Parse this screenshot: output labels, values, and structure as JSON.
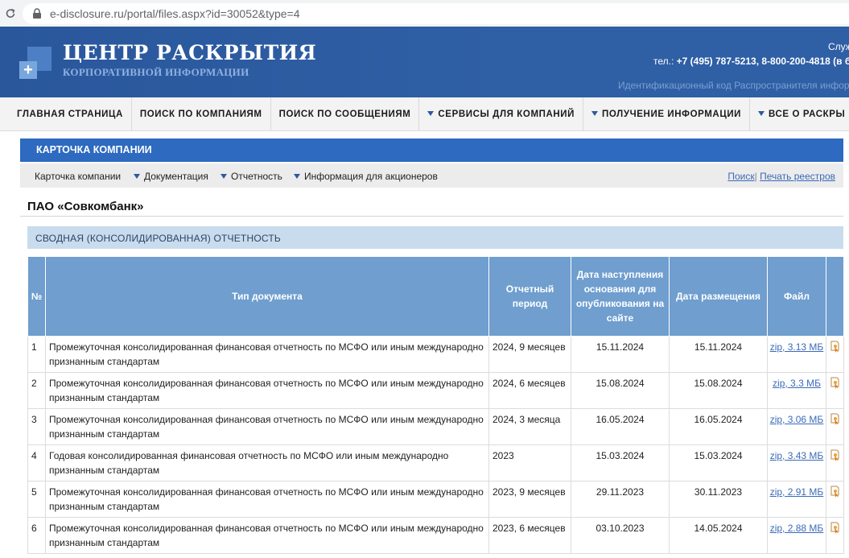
{
  "browser": {
    "url": "e-disclosure.ru/portal/files.aspx?id=30052&type=4"
  },
  "header": {
    "title": "ЦЕНТР РАСКРЫТИЯ",
    "subtitle": "КОРПОРАТИВНОЙ ИНФОРМАЦИИ",
    "service_label": "Служ",
    "phone_label": "тел.: ",
    "phone_values": "+7 (495) 787-5213, 8-800-200-4818 (в б",
    "distributor_id": "Идентификационный код Распространителя инфор"
  },
  "main_nav": [
    {
      "label": "ГЛАВНАЯ СТРАНИЦА",
      "dropdown": false
    },
    {
      "label": "ПОИСК ПО КОМПАНИЯМ",
      "dropdown": false
    },
    {
      "label": "ПОИСК ПО СООБЩЕНИЯМ",
      "dropdown": false
    },
    {
      "label": "СЕРВИСЫ ДЛЯ КОМПАНИЙ",
      "dropdown": true
    },
    {
      "label": "ПОЛУЧЕНИЕ ИНФОРМАЦИИ",
      "dropdown": true
    },
    {
      "label": "ВСЕ О РАСКРЫ",
      "dropdown": true
    }
  ],
  "card": {
    "title": "КАРТОЧКА КОМПАНИИ",
    "subnav": [
      {
        "label": "Карточка компании",
        "dropdown": false
      },
      {
        "label": "Документация",
        "dropdown": true
      },
      {
        "label": "Отчетность",
        "dropdown": true
      },
      {
        "label": "Информация для акционеров",
        "dropdown": true
      }
    ],
    "search_link": "Поиск",
    "separator": "|",
    "print_link": "Печать реестров"
  },
  "company_name": "ПАО «Совкомбанк»",
  "section_title": "СВОДНАЯ (КОНСОЛИДИРОВАННАЯ) ОТЧЕТНОСТЬ",
  "table": {
    "headers": {
      "num": "№",
      "type": "Тип документа",
      "period": "Отчетный период",
      "basis_date": "Дата наступления основания для опубликования на сайте",
      "placed_date": "Дата размещения",
      "file": "Файл"
    },
    "rows": [
      {
        "num": "1",
        "type": "Промежуточная консолидированная финансовая отчетность по МСФО или иным международно признанным стандартам",
        "period": "2024, 9 месяцев",
        "basis_date": "15.11.2024",
        "placed_date": "15.11.2024",
        "file": "zip, 3.13 МБ"
      },
      {
        "num": "2",
        "type": "Промежуточная консолидированная финансовая отчетность по МСФО или иным международно признанным стандартам",
        "period": "2024, 6 месяцев",
        "basis_date": "15.08.2024",
        "placed_date": "15.08.2024",
        "file": "zip, 3.3 МБ"
      },
      {
        "num": "3",
        "type": "Промежуточная консолидированная финансовая отчетность по МСФО или иным международно признанным стандартам",
        "period": "2024, 3 месяца",
        "basis_date": "16.05.2024",
        "placed_date": "16.05.2024",
        "file": "zip, 3.06 МБ"
      },
      {
        "num": "4",
        "type": "Годовая консолидированная финансовая отчетность по МСФО или иным международно признанным стандартам",
        "period": "2023",
        "basis_date": "15.03.2024",
        "placed_date": "15.03.2024",
        "file": "zip, 3.43 МБ"
      },
      {
        "num": "5",
        "type": "Промежуточная консолидированная финансовая отчетность по МСФО или иным международно признанным стандартам",
        "period": "2023, 9 месяцев",
        "basis_date": "29.11.2023",
        "placed_date": "30.11.2023",
        "file": "zip, 2.91 МБ"
      },
      {
        "num": "6",
        "type": "Промежуточная консолидированная финансовая отчетность по МСФО или иным международно признанным стандартам",
        "period": "2023, 6 месяцев",
        "basis_date": "03.10.2023",
        "placed_date": "14.05.2024",
        "file": "zip, 2.88 МБ"
      }
    ]
  },
  "colors": {
    "header_bg": "#2f5fa5",
    "card_header_bg": "#2d6ac0",
    "table_header_bg": "#6f9ecf",
    "section_bg": "#c9dcee",
    "link": "#3b6ab8"
  }
}
